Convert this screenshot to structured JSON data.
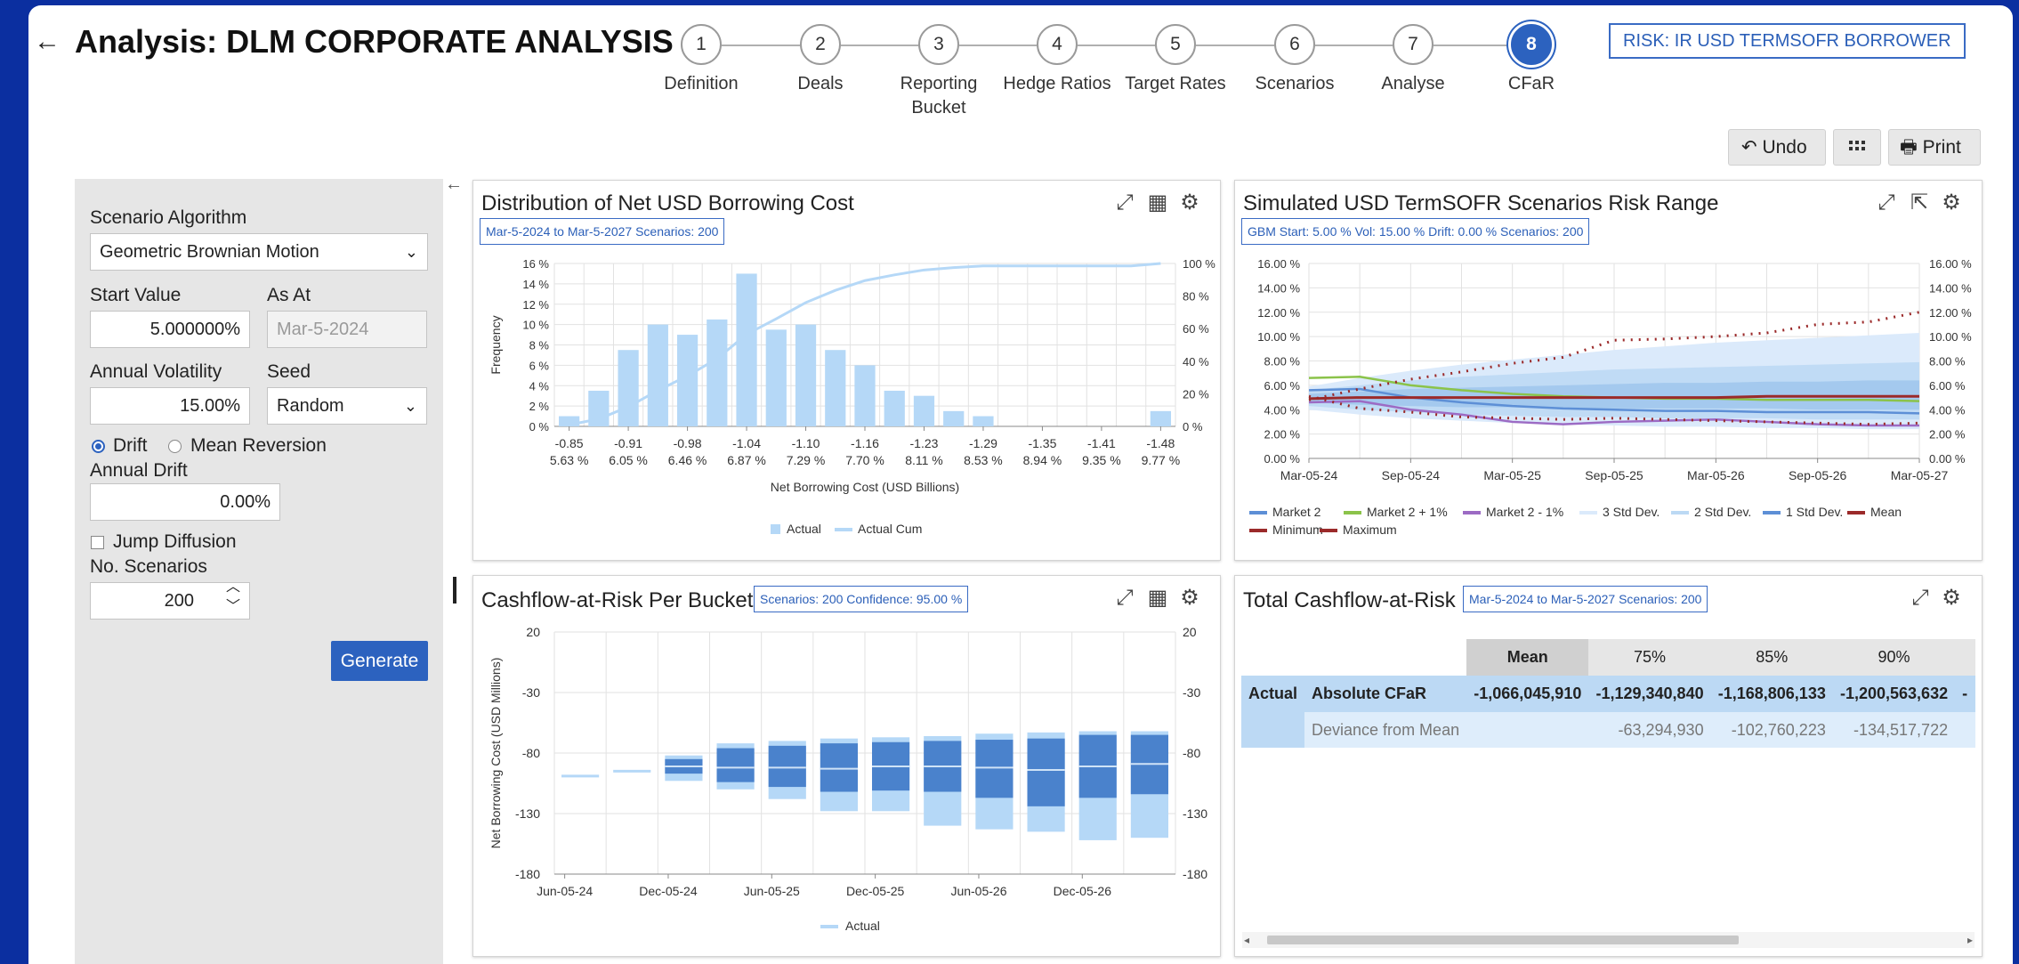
{
  "header": {
    "back_icon": "arrow-left-icon",
    "title": "Analysis: DLM CORPORATE ANALYSIS",
    "risk_label": "RISK: IR USD TERMSOFR BORROWER"
  },
  "steps": [
    {
      "num": "1",
      "label": "Definition"
    },
    {
      "num": "2",
      "label": "Deals"
    },
    {
      "num": "3",
      "label": "Reporting Bucket"
    },
    {
      "num": "4",
      "label": "Hedge Ratios"
    },
    {
      "num": "5",
      "label": "Target Rates"
    },
    {
      "num": "6",
      "label": "Scenarios"
    },
    {
      "num": "7",
      "label": "Analyse"
    },
    {
      "num": "8",
      "label": "CFaR"
    }
  ],
  "toolbar": {
    "undo": "Undo",
    "print": "Print"
  },
  "form": {
    "algorithm_label": "Scenario Algorithm",
    "algorithm_value": "Geometric Brownian Motion",
    "start_label": "Start Value",
    "start_value": "5.000000%",
    "asat_label": "As At",
    "asat_placeholder": "Mar-5-2024",
    "vol_label": "Annual Volatility",
    "vol_value": "15.00%",
    "seed_label": "Seed",
    "seed_value": "Random",
    "drift_option": "Drift",
    "meanrev_option": "Mean Reversion",
    "drift_label": "Annual Drift",
    "drift_value": "0.00%",
    "jump_label": "Jump Diffusion",
    "nscen_label": "No. Scenarios",
    "nscen_value": "200",
    "generate": "Generate"
  },
  "card1": {
    "title": "Distribution of Net USD Borrowing Cost",
    "subtitle": "Mar-5-2024 to Mar-5-2027 Scenarios: 200"
  },
  "card2": {
    "title": "Simulated USD TermSOFR Scenarios Risk Range",
    "subtitle": "GBM Start: 5.00 % Vol: 15.00 % Drift: 0.00 % Scenarios: 200"
  },
  "card3": {
    "title": "Cashflow-at-Risk Per Bucket",
    "subtitle": "Scenarios: 200 Confidence: 95.00 %"
  },
  "card4": {
    "title": "Total Cashflow-at-Risk",
    "subtitle": "Mar-5-2024 to Mar-5-2027 Scenarios: 200"
  },
  "cfar_table": {
    "headers": [
      "Mean",
      "75%",
      "85%",
      "90%"
    ],
    "row_group": "Actual",
    "rows": [
      {
        "label": "Absolute CFaR",
        "values": [
          "-1,066,045,910",
          "-1,129,340,840",
          "-1,168,806,133",
          "-1,200,563,632"
        ]
      },
      {
        "label": "Deviance from Mean",
        "values": [
          "",
          "-63,294,930",
          "-102,760,223",
          "-134,517,722"
        ]
      }
    ]
  },
  "chart_data": [
    {
      "type": "bar",
      "title": "Distribution of Net USD Borrowing Cost",
      "xlabel": "Net Borrowing Cost (USD Billions)",
      "ylabel": "Frequency",
      "ylim": [
        0,
        16
      ],
      "y_ticks": [
        "0 %",
        "2 %",
        "4 %",
        "6 %",
        "8 %",
        "10 %",
        "12 %",
        "14 %",
        "16 %"
      ],
      "y2_ticks": [
        "0 %",
        "20 %",
        "40 %",
        "60 %",
        "80 %",
        "100 %"
      ],
      "x_tick_labels": [
        "-0.85",
        "-0.91",
        "-0.98",
        "-1.04",
        "-1.10",
        "-1.16",
        "-1.23",
        "-1.29",
        "-1.35",
        "-1.41",
        "-1.48"
      ],
      "x_tick_labels2": [
        "5.63 %",
        "6.05 %",
        "6.46 %",
        "6.87 %",
        "7.29 %",
        "7.70 %",
        "8.11 %",
        "8.53 %",
        "8.94 %",
        "9.35 %",
        "9.77 %"
      ],
      "series": [
        {
          "name": "Actual",
          "values": [
            1.0,
            3.5,
            7.5,
            10.0,
            9.0,
            10.5,
            15.0,
            9.5,
            10.0,
            7.5,
            6.0,
            3.5,
            3.0,
            1.5,
            1.0,
            0,
            0,
            0,
            0,
            0,
            1.5
          ]
        },
        {
          "name": "Actual Cum",
          "values": [
            1,
            4.5,
            12,
            22,
            31,
            41.5,
            56.5,
            66,
            76,
            83.5,
            89.5,
            93,
            96,
            97.5,
            98.5,
            98.5,
            98.5,
            98.5,
            98.5,
            98.5,
            100
          ]
        }
      ],
      "legend": "bottom"
    },
    {
      "type": "line",
      "title": "Simulated USD TermSOFR Scenarios Risk Range",
      "ylim": [
        0,
        16
      ],
      "y_ticks": [
        "0.00 %",
        "2.00 %",
        "4.00 %",
        "6.00 %",
        "8.00 %",
        "10.00 %",
        "12.00 %",
        "14.00 %",
        "16.00 %"
      ],
      "x_ticks": [
        "Mar-05-24",
        "Sep-05-24",
        "Mar-05-25",
        "Sep-05-25",
        "Mar-05-26",
        "Sep-05-26",
        "Mar-05-27"
      ],
      "legend_entries": [
        "Market 2",
        "Market 2 + 1%",
        "Market 2 - 1%",
        "3 Std Dev.",
        "2 Std Dev.",
        "1 Std Dev.",
        "Mean",
        "Minimum",
        "Maximum"
      ],
      "series": [
        {
          "name": "Market 2",
          "values": [
            5.6,
            5.7,
            5.0,
            4.6,
            4.3,
            4.1,
            4.0,
            3.9,
            3.9,
            3.8,
            3.8,
            3.8,
            3.7
          ]
        },
        {
          "name": "Market 2 + 1%",
          "values": [
            6.6,
            6.7,
            6.0,
            5.6,
            5.3,
            5.1,
            5.0,
            4.9,
            4.9,
            4.8,
            4.8,
            4.8,
            4.7
          ]
        },
        {
          "name": "Market 2 - 1%",
          "values": [
            4.6,
            4.7,
            4.0,
            3.6,
            3.0,
            2.8,
            3.0,
            3.1,
            3.2,
            3.0,
            2.8,
            2.7,
            2.7
          ]
        },
        {
          "name": "Mean",
          "values": [
            4.9,
            5.0,
            5.0,
            5.0,
            5.0,
            5.0,
            5.0,
            5.0,
            5.0,
            5.1,
            5.1,
            5.1,
            5.1
          ]
        },
        {
          "name": "Minimum",
          "values": [
            5.1,
            4.1,
            3.8,
            3.4,
            3.3,
            3.2,
            3.3,
            3.2,
            3.1,
            3.0,
            2.9,
            2.8,
            2.9
          ]
        },
        {
          "name": "Maximum",
          "values": [
            4.8,
            5.7,
            6.5,
            7.1,
            7.8,
            8.3,
            9.7,
            9.8,
            10.0,
            10.3,
            11.0,
            11.2,
            12.0
          ]
        },
        {
          "name": "1 Std Dev.",
          "values_low": [
            4.6,
            4.4,
            4.3,
            4.2,
            4.2,
            4.1,
            4.1,
            4.1,
            4.1,
            4.1,
            4.0,
            4.0,
            4.0
          ],
          "values_high": [
            5.3,
            5.5,
            5.7,
            5.8,
            5.9,
            6.0,
            6.1,
            6.2,
            6.2,
            6.3,
            6.3,
            6.4,
            6.4
          ]
        },
        {
          "name": "2 Std Dev.",
          "values_low": [
            4.3,
            4.0,
            3.8,
            3.6,
            3.5,
            3.4,
            3.4,
            3.3,
            3.3,
            3.3,
            3.2,
            3.2,
            3.2
          ],
          "values_high": [
            5.6,
            6.0,
            6.4,
            6.7,
            6.9,
            7.1,
            7.3,
            7.4,
            7.5,
            7.6,
            7.7,
            7.8,
            7.9
          ]
        },
        {
          "name": "3 Std Dev.",
          "values_low": [
            4.0,
            3.6,
            3.3,
            3.1,
            2.9,
            2.8,
            2.7,
            2.6,
            2.6,
            2.5,
            2.5,
            2.4,
            2.4
          ],
          "values_high": [
            5.9,
            6.6,
            7.2,
            7.7,
            8.1,
            8.5,
            8.9,
            9.2,
            9.5,
            9.7,
            9.9,
            10.1,
            10.3
          ]
        }
      ],
      "legend": "bottom"
    },
    {
      "type": "bar",
      "title": "Cashflow-at-Risk Per Bucket",
      "ylabel": "Net Borrowing Cost (USD Millions)",
      "ylim": [
        -180,
        20
      ],
      "y_ticks": [
        "20",
        "-30",
        "-80",
        "-130",
        "-180"
      ],
      "x_ticks": [
        "Jun-05-24",
        "Dec-05-24",
        "Jun-05-25",
        "Dec-05-25",
        "Jun-05-26",
        "Dec-05-26"
      ],
      "buckets": [
        {
          "mean": -99
        },
        {
          "mean": -95
        },
        {
          "p5": -103,
          "q1": -97,
          "median": -91,
          "q3": -85,
          "p95": -82
        },
        {
          "p5": -110,
          "q1": -104,
          "median": -92,
          "q3": -76,
          "p95": -72
        },
        {
          "p5": -118,
          "q1": -108,
          "median": -92,
          "q3": -74,
          "p95": -70
        },
        {
          "p5": -128,
          "q1": -112,
          "median": -93,
          "q3": -72,
          "p95": -68
        },
        {
          "p5": -128,
          "q1": -111,
          "median": -91,
          "q3": -71,
          "p95": -67
        },
        {
          "p5": -140,
          "q1": -112,
          "median": -91,
          "q3": -70,
          "p95": -66
        },
        {
          "p5": -143,
          "q1": -117,
          "median": -92,
          "q3": -69,
          "p95": -64
        },
        {
          "p5": -145,
          "q1": -124,
          "median": -94,
          "q3": -68,
          "p95": -63
        },
        {
          "p5": -152,
          "q1": -117,
          "median": -91,
          "q3": -65,
          "p95": -62
        },
        {
          "p5": -150,
          "q1": -114,
          "median": -89,
          "q3": -65,
          "p95": -62
        }
      ],
      "series": [
        {
          "name": "Actual"
        }
      ],
      "legend": "bottom"
    }
  ]
}
